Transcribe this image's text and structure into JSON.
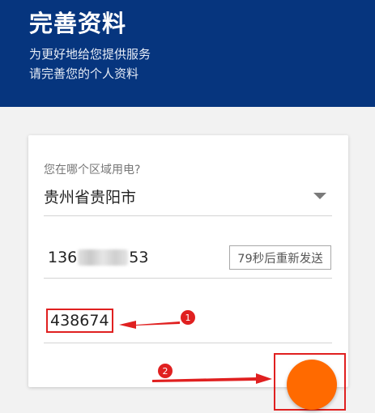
{
  "header": {
    "title": "完善资料",
    "subtitle_line1": "为更好地给您提供服务",
    "subtitle_line2": "请完善您的个人资料"
  },
  "form": {
    "region_label": "您在哪个区域用电?",
    "region_value": "贵州省贵阳市",
    "phone_prefix": "136",
    "phone_suffix": "53",
    "resend_label": "79秒后重新发送",
    "verification_code": "438674"
  },
  "annotations": {
    "marker1": "1",
    "marker2": "2"
  },
  "colors": {
    "header_bg": "#06357e",
    "highlight_red": "#e02020",
    "submit_orange": "#ff6a00"
  }
}
